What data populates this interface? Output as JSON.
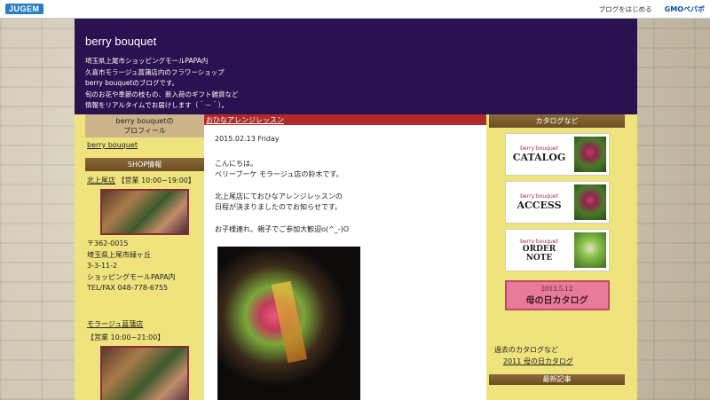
{
  "topbar": {
    "logo": "JUGEM",
    "make_blog": "ブログをはじめる",
    "gmo": "GMOペパボ"
  },
  "header": {
    "title": "berry bouquet",
    "desc": [
      "埼玉県上尾市ショッピングモールPAPA内",
      "久喜市モラージュ菖蒲店内のフラワーショップ",
      "berry bouquetのブログです。",
      "旬のお花や季節の枝もの、新入荷のギフト雑貨など",
      "情報をリアルタイムでお届けします（＾－＾）。"
    ]
  },
  "left": {
    "profile_head": "berry bouquetの\nプロフィール",
    "profile_link": "berry bouquet",
    "shop_head": "SHOP情報",
    "shop1_name": "北上尾店",
    "shop1_hours": "【営業 10:00~19:00】",
    "shop1_addr": [
      "〒362-0015",
      "埼玉県上尾市緑ヶ丘",
      "3-3-11-2",
      "ショッピングモールPAPA内",
      "TEL/FAX 048-778-6755"
    ],
    "shop2_name": "モラージュ菖蒲店",
    "shop2_hours": "【営業 10:00~21:00】"
  },
  "main": {
    "post_title": "おひなアレンジレッスン",
    "date": "2015.02.13 Friday",
    "para1": [
      "こんにちは。",
      "ベリーブーケ モラージュ店の鈴木です。"
    ],
    "para2": [
      "北上尾店にておひなアレンジレッスンの",
      "日程が決まりましたのでお知らせです。"
    ],
    "para3": [
      "お子様連れ、親子でご参加大歓迎o(^_-)O"
    ]
  },
  "right": {
    "catalog_head": "カタログなど",
    "brand": "berry bouquet",
    "cat1": "CATALOG",
    "cat2": "ACCESS",
    "cat3": "ORDER NOTE",
    "mother_date": "2013.5.12",
    "mother_title": "母の日カタログ",
    "past_label": "過去のカタログなど",
    "past_link": "2011 母の日カタログ",
    "recent_head": "最新記事"
  }
}
